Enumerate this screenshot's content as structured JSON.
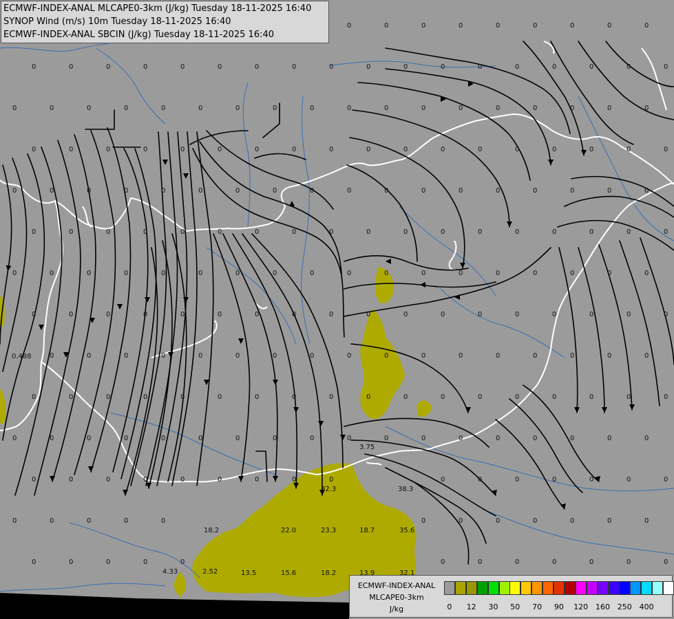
{
  "header": {
    "line1": "ECMWF-INDEX-ANAL MLCAPE0-3km (J/kg) Tuesday 18-11-2025 16:40",
    "line2": "SYNOP Wind (m/s) 10m Tuesday 18-11-2025 16:40",
    "line3": "ECMWF-INDEX-ANAL SBCIN (J/kg) Tuesday 18-11-2025 16:40"
  },
  "legend": {
    "title": "ECMWF-INDEX-ANAL",
    "subtitle": "MLCAPE0-3km",
    "unit": "J/kg",
    "tick_labels": [
      "0",
      "12",
      "30",
      "50",
      "70",
      "90",
      "120",
      "160",
      "250",
      "400"
    ],
    "colors": [
      "#9b9b9b",
      "#a8a400",
      "#9a9600",
      "#00a000",
      "#00e000",
      "#a0f000",
      "#ffff00",
      "#ffc800",
      "#ff9600",
      "#ff6400",
      "#e63200",
      "#b40000",
      "#ff00ff",
      "#c800ff",
      "#7800ff",
      "#3c00ff",
      "#0000ff",
      "#0096ff",
      "#00dcff",
      "#96ffff",
      "#ffffff"
    ]
  },
  "colors": {
    "background": "#9b9b9b",
    "cape_fill": "#aeaa00",
    "border": "#ffffff",
    "river": "#3a6fb0",
    "streamline": "#000000",
    "bottom_band": "#000000"
  },
  "map_values": [
    "0",
    "0.488",
    "3.75",
    "38.3",
    "32.3",
    "18.2",
    "22.0",
    "23.3",
    "18.7",
    "35.6",
    "4.33",
    "2.52",
    "13.5",
    "15.6",
    "18.2",
    "13.9",
    "32.1"
  ]
}
